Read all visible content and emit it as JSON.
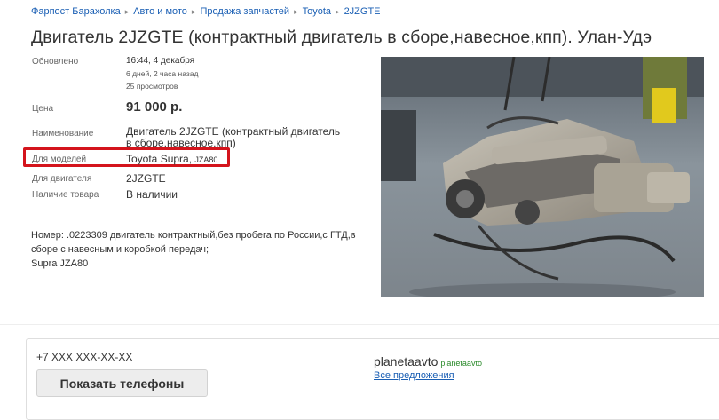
{
  "breadcrumb": [
    "Фарпост Барахолка",
    "Авто и мото",
    "Продажа запчастей",
    "Toyota",
    "2JZGTE"
  ],
  "separator": "▸",
  "title": "Двигатель 2JZGTE (контрактный двигатель в сборе,навесное,кпп). Улан-Удэ",
  "details": {
    "updated_label": "Обновлено",
    "updated_value": "16:44, 4 декабря",
    "updated_ago": "6 дней, 2 часа назад",
    "views": "25 просмотров",
    "price_label": "Цена",
    "price_value": "91 000 р.",
    "name_label": "Наименование",
    "name_value": "Двигатель 2JZGTE (контрактный двигатель в сборе,навесное,кпп)",
    "models_label": "Для моделей",
    "models_value": "Toyota Supra,",
    "models_code": "JZA80",
    "engine_label": "Для двигателя",
    "engine_value": "2JZGTE",
    "availability_label": "Наличие товара",
    "availability_value": "В наличии"
  },
  "description": {
    "line1": "Номер: .0223309 двигатель контрактный,без пробега по России,с ГТД,в сборе с навесным и коробкой передач;",
    "line2": "Supra JZA80"
  },
  "contact": {
    "phone_mask": "+7 XXX XXX-XX-XX",
    "show_phones": "Показать телефоны",
    "seller_name": "planetaavto",
    "seller_nick": "planetaavto",
    "all_offers": "Все предложения"
  },
  "colors": {
    "link": "#1a5fb4",
    "highlight": "#d4141c",
    "nick": "#2a8a2a"
  }
}
